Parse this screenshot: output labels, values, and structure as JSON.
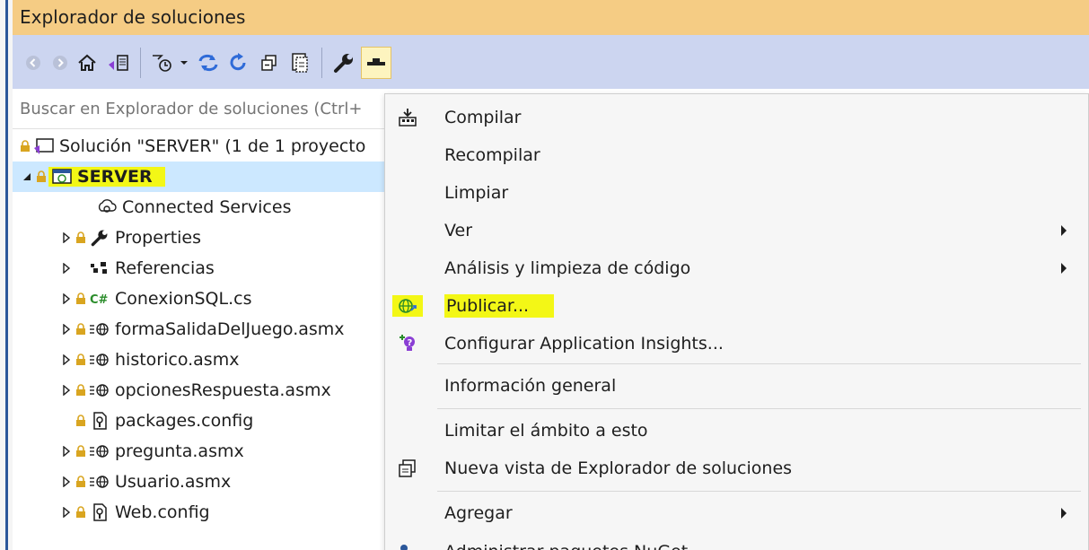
{
  "window": {
    "title": "Explorador de soluciones"
  },
  "search": {
    "placeholder": "Buscar en Explorador de soluciones (Ctrl+"
  },
  "toolbar": {
    "icons": [
      "back-icon",
      "forward-icon",
      "home-icon",
      "switch-views-icon",
      "pending-changes-icon",
      "dropdown-icon",
      "sync-icon",
      "refresh-icon",
      "collapse-all-icon",
      "show-all-files-icon",
      "properties-wrench-icon",
      "preview-selected-icon"
    ]
  },
  "tree": {
    "solution_label": "Solución \"SERVER\" (1 de 1 proyecto",
    "project_label": "SERVER",
    "items": [
      {
        "label": "Connected Services",
        "icon": "connected-services-icon"
      },
      {
        "label": "Properties",
        "icon": "wrench-icon"
      },
      {
        "label": "Referencias",
        "icon": "references-icon"
      },
      {
        "label": "ConexionSQL.cs",
        "icon": "csharp-file-icon"
      },
      {
        "label": "formaSalidaDelJuego.asmx",
        "icon": "asmx-file-icon"
      },
      {
        "label": "historico.asmx",
        "icon": "asmx-file-icon"
      },
      {
        "label": "opcionesRespuesta.asmx",
        "icon": "asmx-file-icon"
      },
      {
        "label": "packages.config",
        "icon": "config-file-icon"
      },
      {
        "label": "pregunta.asmx",
        "icon": "asmx-file-icon"
      },
      {
        "label": "Usuario.asmx",
        "icon": "asmx-file-icon"
      },
      {
        "label": "Web.config",
        "icon": "config-file-icon"
      }
    ]
  },
  "context_menu": {
    "items": [
      {
        "label": "Compilar"
      },
      {
        "label": "Recompilar"
      },
      {
        "label": "Limpiar"
      },
      {
        "label": "Ver"
      },
      {
        "label": "Análisis y limpieza de código"
      },
      {
        "label": "Publicar..."
      },
      {
        "label": "Configurar Application Insights..."
      },
      {
        "label": "Información general"
      },
      {
        "label": "Limitar el ámbito a esto"
      },
      {
        "label": "Nueva vista de Explorador de soluciones"
      },
      {
        "label": "Agregar"
      },
      {
        "label": "Administrar paquetes NuGet..."
      }
    ]
  },
  "colors": {
    "title_bar": "#f5cc84",
    "toolbar": "#ccd5f0",
    "selection": "#cce8ff",
    "highlight": "#f3f716",
    "menu_bg": "#f6f6f6"
  }
}
